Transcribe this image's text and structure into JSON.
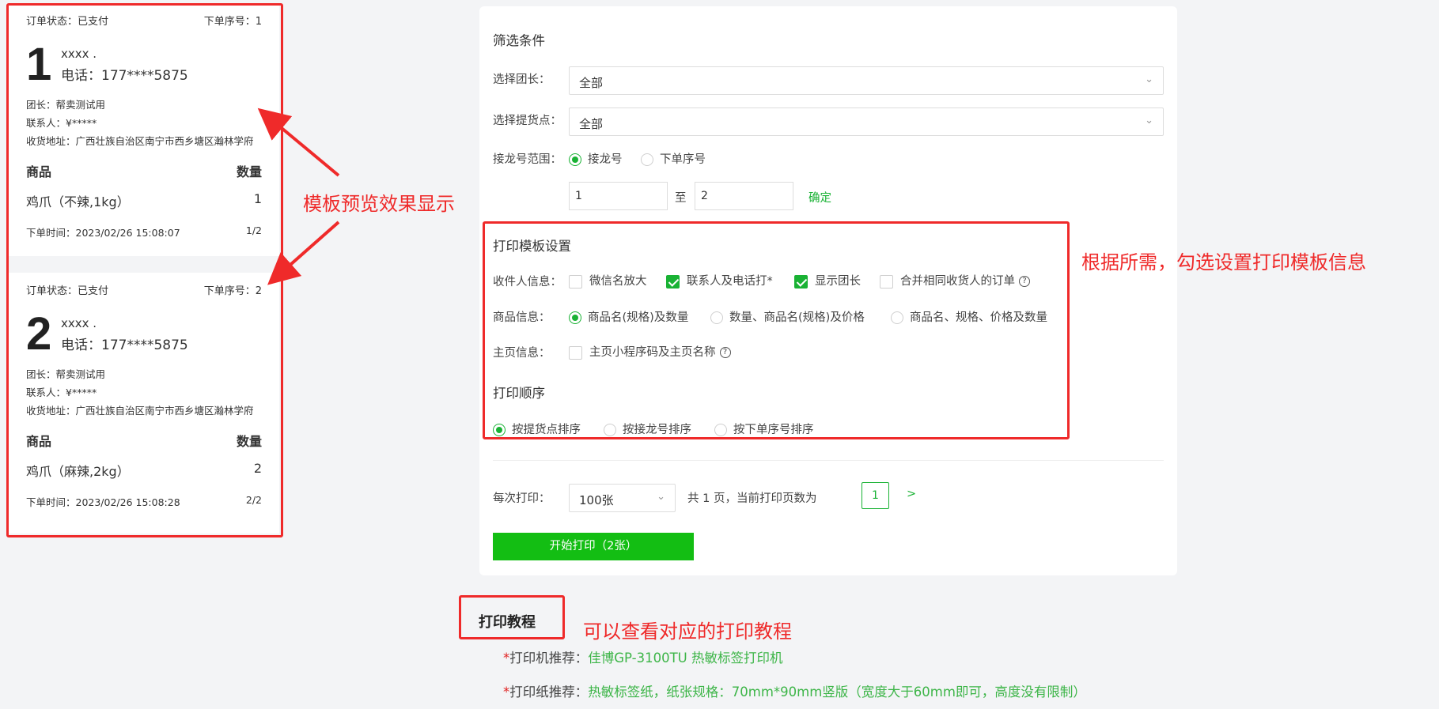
{
  "orders": [
    {
      "status_label": "订单状态：已支付",
      "seq_label": "下单序号：1",
      "big_number": "1",
      "name": "xxxx .",
      "phone": "电话：177****5875",
      "leader": "团长：帮卖测试用",
      "contact": "联系人：¥*****",
      "address": "收货地址：广西壮族自治区南宁市西乡塘区瀚林学府",
      "col_goods": "商品",
      "col_qty": "数量",
      "item_name": "鸡爪（不辣,1kg）",
      "item_qty": "1",
      "time": "下单时间：2023/02/26 15:08:07",
      "page": "1/2"
    },
    {
      "status_label": "订单状态：已支付",
      "seq_label": "下单序号：2",
      "big_number": "2",
      "name": "xxxx .",
      "phone": "电话：177****5875",
      "leader": "团长：帮卖测试用",
      "contact": "联系人：¥*****",
      "address": "收货地址：广西壮族自治区南宁市西乡塘区瀚林学府",
      "col_goods": "商品",
      "col_qty": "数量",
      "item_name": "鸡爪（麻辣,2kg）",
      "item_qty": "2",
      "time": "下单时间：2023/02/26 15:08:28",
      "page": "2/2"
    }
  ],
  "filter": {
    "title": "筛选条件",
    "leader_label": "选择团长：",
    "leader_value": "全部",
    "pickup_label": "选择提货点：",
    "pickup_value": "全部",
    "range_label": "接龙号范围：",
    "range_opt1": "接龙号",
    "range_opt2": "下单序号",
    "range_from": "1",
    "range_to_label": "至",
    "range_to": "2",
    "confirm": "确定"
  },
  "template": {
    "title": "打印模板设置",
    "recipient_label": "收件人信息：",
    "recipient_opts": [
      "微信名放大",
      "联系人及电话打*",
      "显示团长",
      "合并相同收货人的订单"
    ],
    "goods_label": "商品信息：",
    "goods_opts": [
      "商品名(规格)及数量",
      "数量、商品名(规格)及价格",
      "商品名、规格、价格及数量"
    ],
    "home_label": "主页信息：",
    "home_opt": "主页小程序码及主页名称",
    "order_title": "打印顺序",
    "order_opts": [
      "按提货点排序",
      "按接龙号排序",
      "按下单序号排序"
    ]
  },
  "paging": {
    "per_label": "每次打印：",
    "per_value": "100张",
    "summary": "共 1 页，当前打印页数为",
    "current": "1",
    "next": ">",
    "print_button": "开始打印（2张）"
  },
  "tutorial": {
    "title": "打印教程",
    "printer_label": "打印机推荐：",
    "printer_value": "佳博GP-3100TU 热敏标签打印机",
    "paper_label": "打印纸推荐：",
    "paper_value": "热敏标签纸，纸张规格：70mm*90mm竖版（宽度大于60mm即可，高度没有限制）",
    "star": "*"
  },
  "annotations": {
    "preview": "模板预览效果显示",
    "template": "根据所需，勾选设置打印模板信息",
    "tutorial": "可以查看对应的打印教程"
  },
  "colors": {
    "accent": "#19b234",
    "annotation": "#ef2a2a"
  },
  "icons": {
    "dropdown": "chevron-down-icon",
    "help": "question-circle-icon"
  }
}
